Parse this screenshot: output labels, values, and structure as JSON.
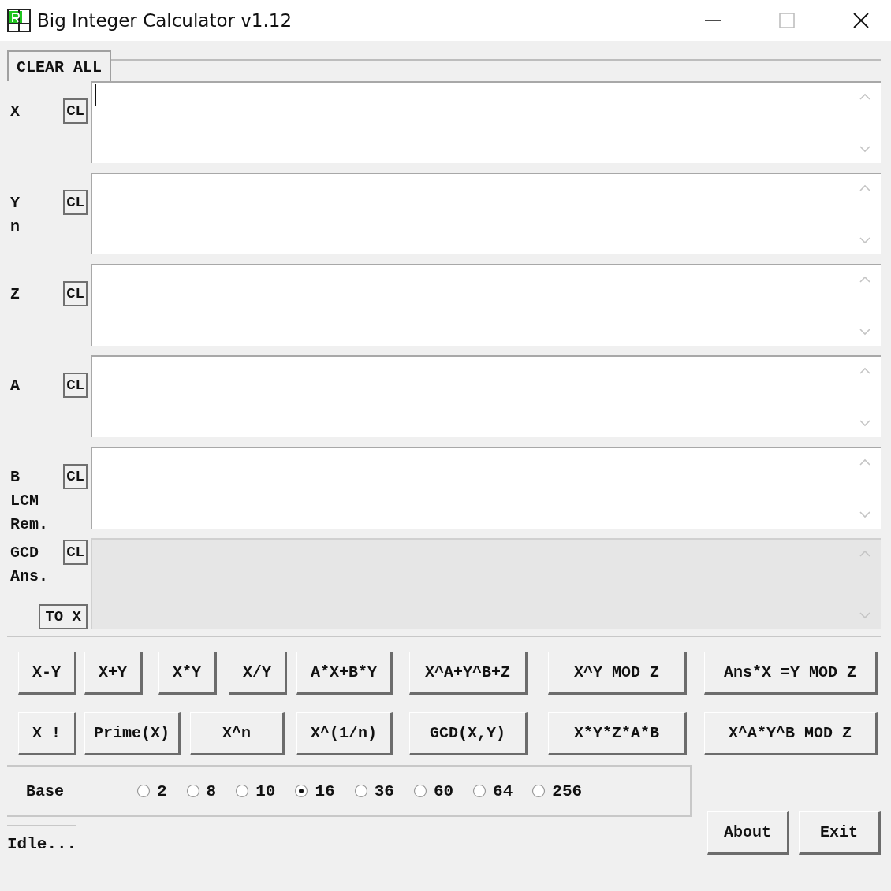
{
  "window": {
    "title": "Big Integer Calculator v1.12"
  },
  "clear_all": {
    "label": "CLEAR ALL"
  },
  "fields": [
    {
      "labels": [
        "X"
      ],
      "clear": "CL",
      "disabled": false,
      "focused": true
    },
    {
      "labels": [
        "Y",
        "n"
      ],
      "clear": "CL",
      "disabled": false,
      "focused": false
    },
    {
      "labels": [
        "Z"
      ],
      "clear": "CL",
      "disabled": false,
      "focused": false
    },
    {
      "labels": [
        "A"
      ],
      "clear": "CL",
      "disabled": false,
      "focused": false
    },
    {
      "labels": [
        "B",
        "LCM",
        "Rem."
      ],
      "clear": "CL",
      "disabled": false,
      "focused": false
    },
    {
      "labels": [
        "GCD",
        "Ans."
      ],
      "clear": "CL",
      "disabled": true,
      "focused": false,
      "extra_button": "TO X"
    }
  ],
  "operations": [
    [
      "X-Y",
      "X+Y",
      "X*Y",
      "X/Y",
      "A*X+B*Y",
      "X^A+Y^B+Z",
      "X^Y MOD Z",
      "Ans*X =Y MOD Z"
    ],
    [
      "X !",
      "Prime(X)",
      "X^n",
      "X^(1/n)",
      "GCD(X,Y)",
      "X*Y*Z*A*B",
      "X^A*Y^B MOD Z"
    ]
  ],
  "base": {
    "label": "Base",
    "options": [
      {
        "label": "2",
        "selected": false
      },
      {
        "label": "8",
        "selected": false
      },
      {
        "label": "10",
        "selected": false
      },
      {
        "label": "16",
        "selected": true
      },
      {
        "label": "36",
        "selected": false
      },
      {
        "label": "60",
        "selected": false
      },
      {
        "label": "64",
        "selected": false
      },
      {
        "label": "256",
        "selected": false
      }
    ]
  },
  "status_bar": "Idle...",
  "buttons": [
    "About",
    "Exit"
  ]
}
